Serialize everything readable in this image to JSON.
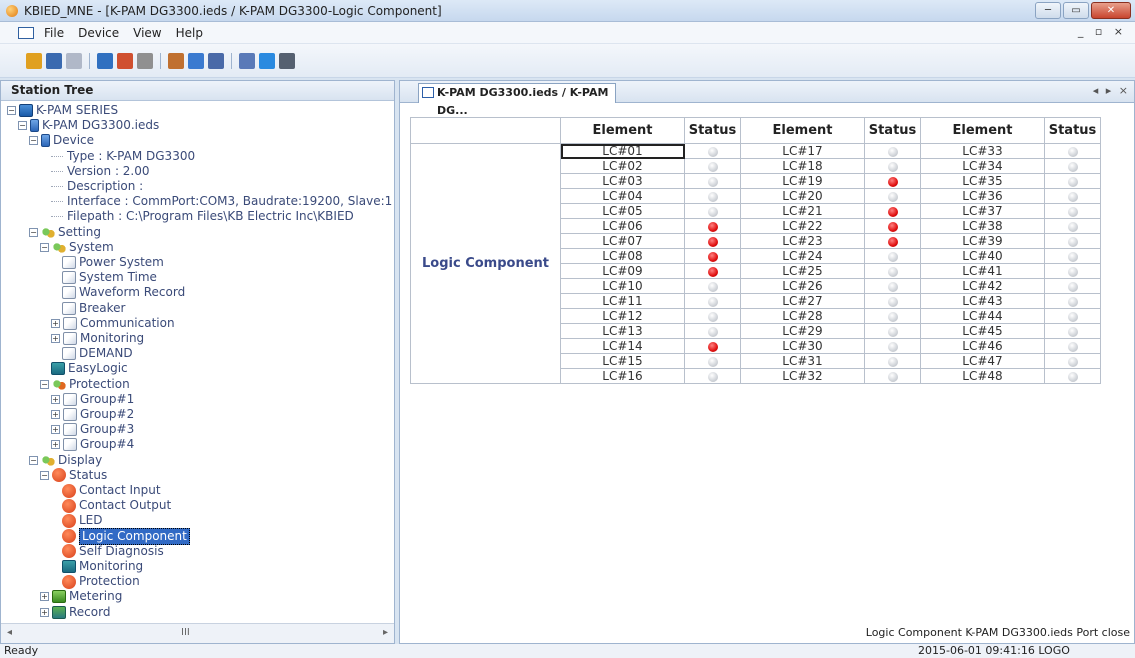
{
  "window": {
    "title": "KBIED_MNE - [K-PAM DG3300.ieds / K-PAM DG3300-Logic Component]",
    "minimize": "─",
    "restore": "▭",
    "close": "✕",
    "mdi_controls": "_ ▫ ×"
  },
  "menu": [
    "File",
    "Device",
    "View",
    "Help"
  ],
  "toolbar": {
    "icons": [
      "open-icon",
      "save-icon",
      "save-all-icon",
      "station-icon",
      "connect-icon",
      "disconnect-icon",
      "upload-icon",
      "download-icon",
      "grid-icon",
      "window-icon",
      "help-icon",
      "more-icon"
    ],
    "colors": [
      "#e0a020",
      "#3a6ab0",
      "#b0b8c8",
      "#3070c0",
      "#d05030",
      "#909090",
      "#c07030",
      "#3a7ad0",
      "#4a6aa8",
      "#5a7ab8",
      "#2a8ae0",
      "#556070"
    ]
  },
  "station_tree": {
    "header": "Station Tree",
    "rows": [
      {
        "text": "K-PAM SERIES",
        "icon": "monitor-icon",
        "level": 0,
        "expander": "−"
      },
      {
        "text": "K-PAM DG3300.ieds",
        "icon": "device-icon",
        "level": 1,
        "expander": "−"
      },
      {
        "text": "Device",
        "icon": "device-icon",
        "level": 2,
        "expander": "−"
      },
      {
        "text": "Type : K-PAM DG3300",
        "icon": "",
        "level": 4,
        "expander": ""
      },
      {
        "text": "Version : 2.00",
        "icon": "",
        "level": 4,
        "expander": ""
      },
      {
        "text": "Description :",
        "icon": "",
        "level": 4,
        "expander": ""
      },
      {
        "text": "Interface : CommPort:COM3, Baudrate:19200, Slave:1",
        "icon": "",
        "level": 4,
        "expander": ""
      },
      {
        "text": "Filepath : C:\\Program Files\\KB Electric Inc\\KBIED",
        "icon": "",
        "level": 4,
        "expander": ""
      },
      {
        "text": "Setting",
        "icon": "gear-icon",
        "level": 2,
        "expander": "−"
      },
      {
        "text": "System",
        "icon": "gear-icon",
        "level": 3,
        "expander": "−"
      },
      {
        "text": "Power System",
        "icon": "page-icon",
        "level": 5,
        "expander": ""
      },
      {
        "text": "System Time",
        "icon": "page-icon",
        "level": 5,
        "expander": ""
      },
      {
        "text": "Waveform Record",
        "icon": "page-icon",
        "level": 5,
        "expander": ""
      },
      {
        "text": "Breaker",
        "icon": "page-icon",
        "level": 5,
        "expander": ""
      },
      {
        "text": "Communication",
        "icon": "page-icon",
        "level": 4,
        "expander": "+"
      },
      {
        "text": "Monitoring",
        "icon": "page-icon",
        "level": 4,
        "expander": "+"
      },
      {
        "text": "DEMAND",
        "icon": "page-icon",
        "level": 5,
        "expander": ""
      },
      {
        "text": "EasyLogic",
        "icon": "easylogic-icon",
        "level": 4,
        "expander": ""
      },
      {
        "text": "Protection",
        "icon": "gear2-icon",
        "level": 3,
        "expander": "−"
      },
      {
        "text": "Group#1",
        "icon": "page-icon",
        "level": 4,
        "expander": "+"
      },
      {
        "text": "Group#2",
        "icon": "page-icon",
        "level": 4,
        "expander": "+"
      },
      {
        "text": "Group#3",
        "icon": "page-icon",
        "level": 4,
        "expander": "+"
      },
      {
        "text": "Group#4",
        "icon": "page-icon",
        "level": 4,
        "expander": "+"
      },
      {
        "text": "Display",
        "icon": "gear-icon",
        "level": 2,
        "expander": "−"
      },
      {
        "text": "Status",
        "icon": "red-circle-icon",
        "level": 3,
        "expander": "−"
      },
      {
        "text": "Contact Input",
        "icon": "red-circle-icon",
        "level": 5,
        "expander": ""
      },
      {
        "text": "Contact Output",
        "icon": "red-circle-icon",
        "level": 5,
        "expander": ""
      },
      {
        "text": "LED",
        "icon": "red-circle-icon",
        "level": 5,
        "expander": ""
      },
      {
        "text": "Logic Component",
        "icon": "red-circle-icon",
        "level": 5,
        "expander": "",
        "selected": true
      },
      {
        "text": "Self Diagnosis",
        "icon": "red-circle-icon",
        "level": 5,
        "expander": ""
      },
      {
        "text": "Monitoring",
        "icon": "monitoring-icon",
        "level": 5,
        "expander": ""
      },
      {
        "text": "Protection",
        "icon": "red-circle-icon",
        "level": 5,
        "expander": ""
      },
      {
        "text": "Metering",
        "icon": "metering-icon",
        "level": 3,
        "expander": "+"
      },
      {
        "text": "Record",
        "icon": "record-icon",
        "level": 3,
        "expander": "+"
      }
    ],
    "scroll_left": "◂",
    "scroll_grip": "III",
    "scroll_right": "▸"
  },
  "document": {
    "tab_label": "K-PAM DG3300.ieds / K-PAM DG...",
    "tab_nav": "◂ ▸ ×",
    "table": {
      "row_label": "Logic Component",
      "headers": [
        "Element",
        "Status",
        "Element",
        "Status",
        "Element",
        "Status"
      ],
      "rows": [
        [
          "LC#01",
          "off",
          "LC#17",
          "off",
          "LC#33",
          "off"
        ],
        [
          "LC#02",
          "off",
          "LC#18",
          "off",
          "LC#34",
          "off"
        ],
        [
          "LC#03",
          "off",
          "LC#19",
          "on",
          "LC#35",
          "off"
        ],
        [
          "LC#04",
          "off",
          "LC#20",
          "off",
          "LC#36",
          "off"
        ],
        [
          "LC#05",
          "off",
          "LC#21",
          "on",
          "LC#37",
          "off"
        ],
        [
          "LC#06",
          "on",
          "LC#22",
          "on",
          "LC#38",
          "off"
        ],
        [
          "LC#07",
          "on",
          "LC#23",
          "on",
          "LC#39",
          "off"
        ],
        [
          "LC#08",
          "on",
          "LC#24",
          "off",
          "LC#40",
          "off"
        ],
        [
          "LC#09",
          "on",
          "LC#25",
          "off",
          "LC#41",
          "off"
        ],
        [
          "LC#10",
          "off",
          "LC#26",
          "off",
          "LC#42",
          "off"
        ],
        [
          "LC#11",
          "off",
          "LC#27",
          "off",
          "LC#43",
          "off"
        ],
        [
          "LC#12",
          "off",
          "LC#28",
          "off",
          "LC#44",
          "off"
        ],
        [
          "LC#13",
          "off",
          "LC#29",
          "off",
          "LC#45",
          "off"
        ],
        [
          "LC#14",
          "on",
          "LC#30",
          "off",
          "LC#46",
          "off"
        ],
        [
          "LC#15",
          "off",
          "LC#31",
          "off",
          "LC#47",
          "off"
        ],
        [
          "LC#16",
          "off",
          "LC#32",
          "off",
          "LC#48",
          "off"
        ]
      ]
    },
    "pane_status": "Logic Component   K-PAM DG3300.ieds   Port close"
  },
  "statusbar": {
    "left": "Ready",
    "right": "2015-06-01 09:41:16   LOGO"
  }
}
